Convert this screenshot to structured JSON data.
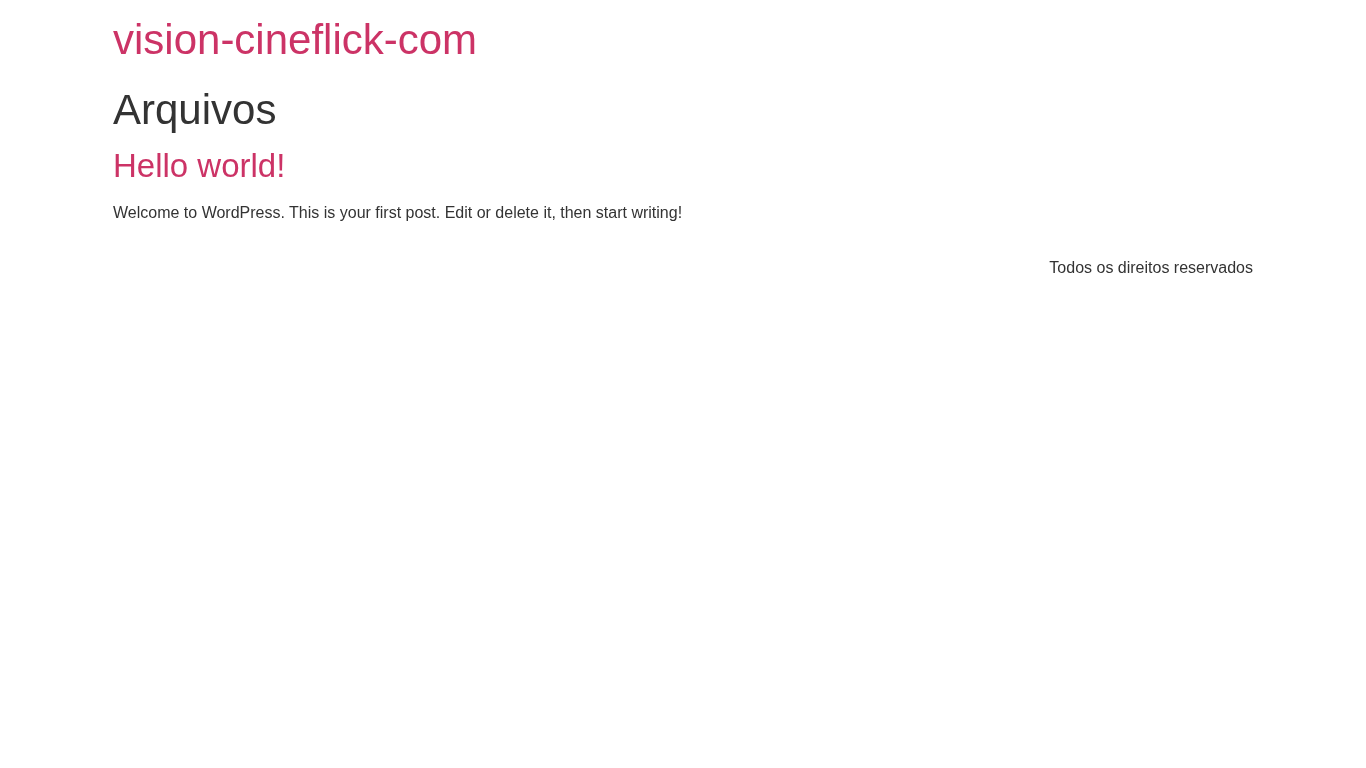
{
  "site_title": "vision-cineflick-com",
  "page_title": "Arquivos",
  "posts": [
    {
      "title": "Hello world!",
      "excerpt": "Welcome to WordPress. This is your first post. Edit or delete it, then start writing!"
    }
  ],
  "footer": {
    "text": "Todos os direitos reservados"
  }
}
